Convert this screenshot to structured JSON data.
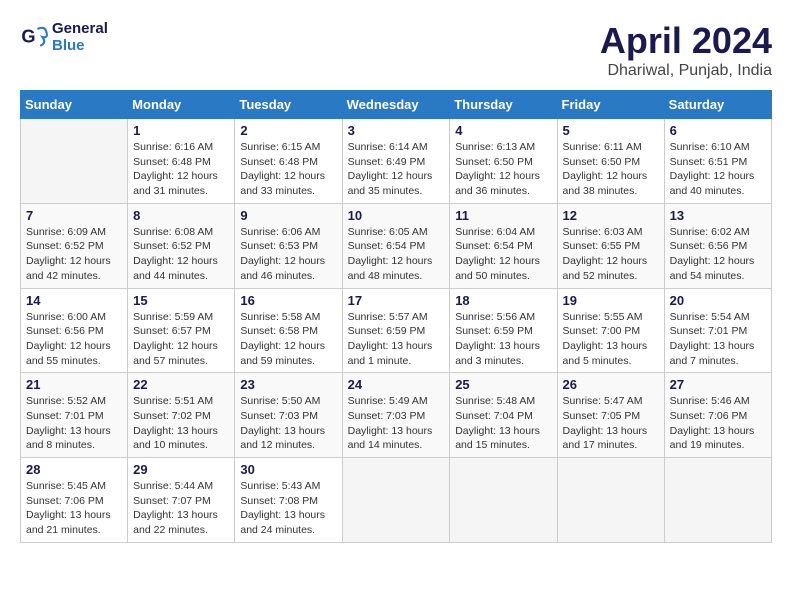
{
  "header": {
    "logo_line1": "General",
    "logo_line2": "Blue",
    "month": "April 2024",
    "location": "Dhariwal, Punjab, India"
  },
  "weekdays": [
    "Sunday",
    "Monday",
    "Tuesday",
    "Wednesday",
    "Thursday",
    "Friday",
    "Saturday"
  ],
  "weeks": [
    [
      {
        "day": "",
        "info": ""
      },
      {
        "day": "1",
        "info": "Sunrise: 6:16 AM\nSunset: 6:48 PM\nDaylight: 12 hours\nand 31 minutes."
      },
      {
        "day": "2",
        "info": "Sunrise: 6:15 AM\nSunset: 6:48 PM\nDaylight: 12 hours\nand 33 minutes."
      },
      {
        "day": "3",
        "info": "Sunrise: 6:14 AM\nSunset: 6:49 PM\nDaylight: 12 hours\nand 35 minutes."
      },
      {
        "day": "4",
        "info": "Sunrise: 6:13 AM\nSunset: 6:50 PM\nDaylight: 12 hours\nand 36 minutes."
      },
      {
        "day": "5",
        "info": "Sunrise: 6:11 AM\nSunset: 6:50 PM\nDaylight: 12 hours\nand 38 minutes."
      },
      {
        "day": "6",
        "info": "Sunrise: 6:10 AM\nSunset: 6:51 PM\nDaylight: 12 hours\nand 40 minutes."
      }
    ],
    [
      {
        "day": "7",
        "info": "Sunrise: 6:09 AM\nSunset: 6:52 PM\nDaylight: 12 hours\nand 42 minutes."
      },
      {
        "day": "8",
        "info": "Sunrise: 6:08 AM\nSunset: 6:52 PM\nDaylight: 12 hours\nand 44 minutes."
      },
      {
        "day": "9",
        "info": "Sunrise: 6:06 AM\nSunset: 6:53 PM\nDaylight: 12 hours\nand 46 minutes."
      },
      {
        "day": "10",
        "info": "Sunrise: 6:05 AM\nSunset: 6:54 PM\nDaylight: 12 hours\nand 48 minutes."
      },
      {
        "day": "11",
        "info": "Sunrise: 6:04 AM\nSunset: 6:54 PM\nDaylight: 12 hours\nand 50 minutes."
      },
      {
        "day": "12",
        "info": "Sunrise: 6:03 AM\nSunset: 6:55 PM\nDaylight: 12 hours\nand 52 minutes."
      },
      {
        "day": "13",
        "info": "Sunrise: 6:02 AM\nSunset: 6:56 PM\nDaylight: 12 hours\nand 54 minutes."
      }
    ],
    [
      {
        "day": "14",
        "info": "Sunrise: 6:00 AM\nSunset: 6:56 PM\nDaylight: 12 hours\nand 55 minutes."
      },
      {
        "day": "15",
        "info": "Sunrise: 5:59 AM\nSunset: 6:57 PM\nDaylight: 12 hours\nand 57 minutes."
      },
      {
        "day": "16",
        "info": "Sunrise: 5:58 AM\nSunset: 6:58 PM\nDaylight: 12 hours\nand 59 minutes."
      },
      {
        "day": "17",
        "info": "Sunrise: 5:57 AM\nSunset: 6:59 PM\nDaylight: 13 hours\nand 1 minute."
      },
      {
        "day": "18",
        "info": "Sunrise: 5:56 AM\nSunset: 6:59 PM\nDaylight: 13 hours\nand 3 minutes."
      },
      {
        "day": "19",
        "info": "Sunrise: 5:55 AM\nSunset: 7:00 PM\nDaylight: 13 hours\nand 5 minutes."
      },
      {
        "day": "20",
        "info": "Sunrise: 5:54 AM\nSunset: 7:01 PM\nDaylight: 13 hours\nand 7 minutes."
      }
    ],
    [
      {
        "day": "21",
        "info": "Sunrise: 5:52 AM\nSunset: 7:01 PM\nDaylight: 13 hours\nand 8 minutes."
      },
      {
        "day": "22",
        "info": "Sunrise: 5:51 AM\nSunset: 7:02 PM\nDaylight: 13 hours\nand 10 minutes."
      },
      {
        "day": "23",
        "info": "Sunrise: 5:50 AM\nSunset: 7:03 PM\nDaylight: 13 hours\nand 12 minutes."
      },
      {
        "day": "24",
        "info": "Sunrise: 5:49 AM\nSunset: 7:03 PM\nDaylight: 13 hours\nand 14 minutes."
      },
      {
        "day": "25",
        "info": "Sunrise: 5:48 AM\nSunset: 7:04 PM\nDaylight: 13 hours\nand 15 minutes."
      },
      {
        "day": "26",
        "info": "Sunrise: 5:47 AM\nSunset: 7:05 PM\nDaylight: 13 hours\nand 17 minutes."
      },
      {
        "day": "27",
        "info": "Sunrise: 5:46 AM\nSunset: 7:06 PM\nDaylight: 13 hours\nand 19 minutes."
      }
    ],
    [
      {
        "day": "28",
        "info": "Sunrise: 5:45 AM\nSunset: 7:06 PM\nDaylight: 13 hours\nand 21 minutes."
      },
      {
        "day": "29",
        "info": "Sunrise: 5:44 AM\nSunset: 7:07 PM\nDaylight: 13 hours\nand 22 minutes."
      },
      {
        "day": "30",
        "info": "Sunrise: 5:43 AM\nSunset: 7:08 PM\nDaylight: 13 hours\nand 24 minutes."
      },
      {
        "day": "",
        "info": ""
      },
      {
        "day": "",
        "info": ""
      },
      {
        "day": "",
        "info": ""
      },
      {
        "day": "",
        "info": ""
      }
    ]
  ]
}
